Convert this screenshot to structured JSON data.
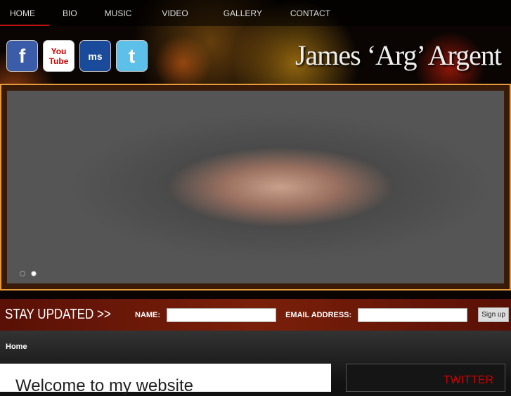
{
  "nav": [
    "HOME",
    "BIO",
    "MUSIC",
    "VIDEO",
    "GALLERY",
    "CONTACT"
  ],
  "social": {
    "facebook": "f",
    "youtube": "You Tube",
    "myspace": "ms",
    "twitter": "t"
  },
  "site_title": "James ‘Arg’ Argent",
  "signup": {
    "heading": "STAY UPDATED >>",
    "name_label": "NAME:",
    "email_label": "EMAIL ADDRESS:",
    "button": "Sign up"
  },
  "breadcrumb": "Home",
  "main": {
    "heading": "Welcome to my website"
  },
  "sidebar": {
    "twitter": "TWITTER"
  }
}
